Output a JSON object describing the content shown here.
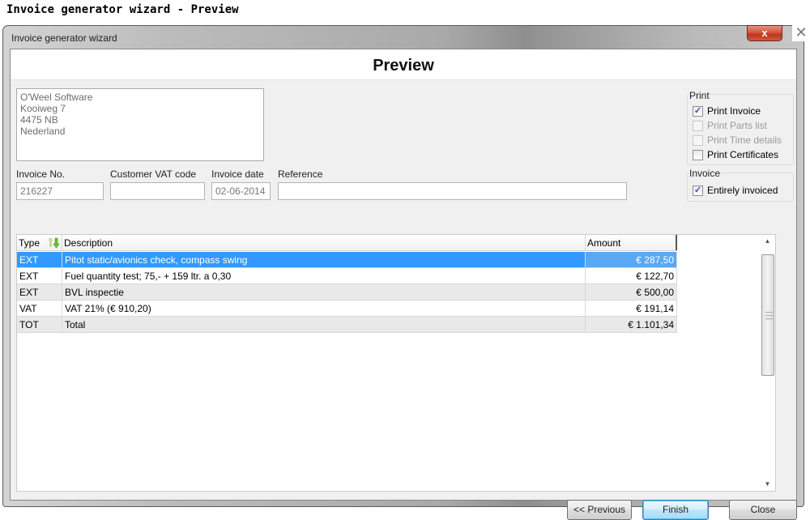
{
  "page": {
    "title": "Invoice generator wizard - Preview"
  },
  "window": {
    "title": "Invoice generator wizard",
    "close_glyph": "x",
    "outer_close_glyph": "✕"
  },
  "header": {
    "title": "Preview"
  },
  "address": {
    "value": "O'Weel Software\nKooiweg 7\n4475 NB\nNederland"
  },
  "fields": {
    "invoice_no": {
      "label": "Invoice No.",
      "value": "216227"
    },
    "customer_vat": {
      "label": "Customer VAT code",
      "value": ""
    },
    "invoice_date": {
      "label": "Invoice date",
      "value": "02-06-2014"
    },
    "reference": {
      "label": "Reference",
      "value": ""
    }
  },
  "print_group": {
    "title": "Print",
    "options": [
      {
        "label": "Print Invoice",
        "checked": true,
        "enabled": true
      },
      {
        "label": "Print Parts list",
        "checked": false,
        "enabled": false
      },
      {
        "label": "Print Time details",
        "checked": false,
        "enabled": false
      },
      {
        "label": "Print Certificates",
        "checked": false,
        "enabled": true
      }
    ]
  },
  "invoice_group": {
    "title": "Invoice",
    "options": [
      {
        "label": "Entirely invoiced",
        "checked": true,
        "enabled": true
      }
    ]
  },
  "grid": {
    "columns": [
      "Type",
      "Description",
      "Amount"
    ],
    "rows": [
      {
        "type": "EXT",
        "description": "Pitot static/avionics check, compass swing",
        "amount": "€ 287,50",
        "selected": true
      },
      {
        "type": "EXT",
        "description": "Fuel quantity test; 75,- + 159 ltr. a 0,30",
        "amount": "€ 122,70",
        "selected": false
      },
      {
        "type": "EXT",
        "description": "BVL inspectie",
        "amount": "€ 500,00",
        "selected": false
      },
      {
        "type": "VAT",
        "description": "VAT 21% (€ 910,20)",
        "amount": "€ 191,14",
        "selected": false
      },
      {
        "type": "TOT",
        "description": "Total",
        "amount": "€ 1.101,34",
        "selected": false
      }
    ]
  },
  "buttons": {
    "previous": "<< Previous",
    "finish": "Finish",
    "close": "Close"
  },
  "colors": {
    "selection": "#3399ff",
    "close_button": "#c9442c"
  }
}
